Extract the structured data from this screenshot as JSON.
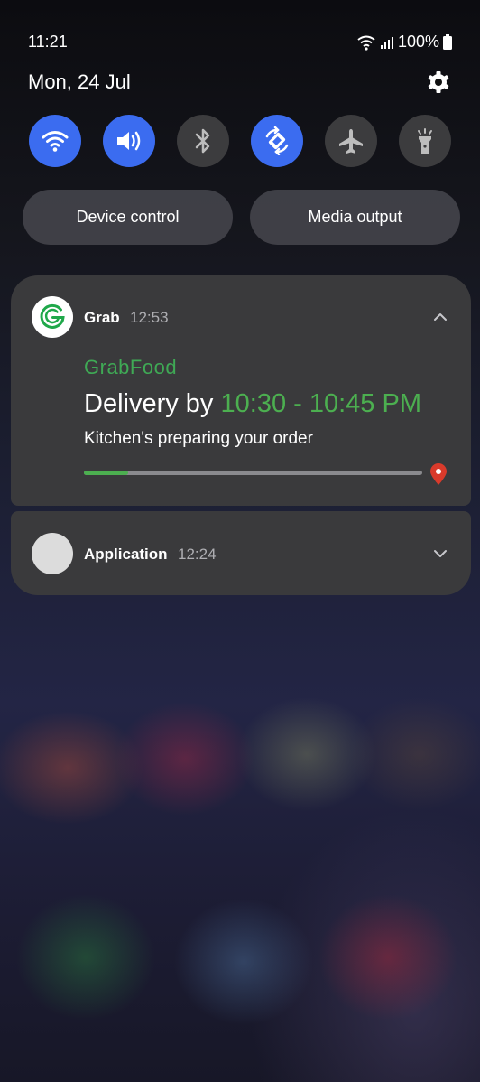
{
  "status_bar": {
    "time": "11:21",
    "battery": "100%"
  },
  "header": {
    "date": "Mon, 24 Jul"
  },
  "quick_settings": [
    {
      "name": "wifi",
      "icon": "wifi-icon",
      "on": true
    },
    {
      "name": "sound",
      "icon": "sound-icon",
      "on": true
    },
    {
      "name": "bluetooth",
      "icon": "bluetooth-icon",
      "on": false
    },
    {
      "name": "auto-rotate",
      "icon": "auto-rotate-icon",
      "on": true
    },
    {
      "name": "airplane-mode",
      "icon": "airplane-icon",
      "on": false
    },
    {
      "name": "flashlight",
      "icon": "flashlight-icon",
      "on": false
    }
  ],
  "buttons": {
    "device_control": "Device control",
    "media_output": "Media output"
  },
  "notifications": {
    "grab": {
      "app": "Grab",
      "time": "12:53",
      "brand": "GrabFood",
      "delivery_prefix": "Delivery by",
      "delivery_window": "10:30 - 10:45 PM",
      "status": "Kitchen's preparing your order",
      "progress": 0.13
    },
    "application": {
      "app": "Application",
      "time": "12:24"
    }
  },
  "colors": {
    "accent": "#3b6cf0",
    "grab_green": "#4caf50",
    "card": "#3a3a3c",
    "pin_red": "#d93a2b"
  }
}
